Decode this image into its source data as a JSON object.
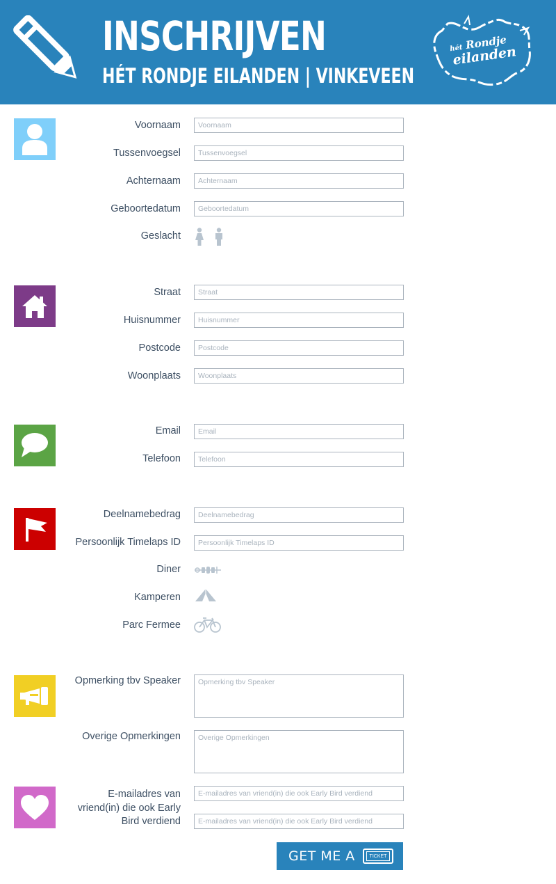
{
  "header": {
    "title": "INSCHRIJVEN",
    "subtitle": "HÉT RONDJE EILANDEN  |  VINKEVEEN",
    "logo_line1_small": "hét",
    "logo_line1": "Rondje",
    "logo_line2": "eilanden",
    "color": "#2983bb"
  },
  "sections": {
    "personal": {
      "icon": "person-icon",
      "color": "#7fcffa",
      "voornaam": {
        "label": "Voornaam",
        "placeholder": "Voornaam"
      },
      "tussenvoegsel": {
        "label": "Tussenvoegsel",
        "placeholder": "Tussenvoegsel"
      },
      "achternaam": {
        "label": "Achternaam",
        "placeholder": "Achternaam"
      },
      "geboortedatum": {
        "label": "Geboortedatum",
        "placeholder": "Geboortedatum"
      },
      "geslacht": {
        "label": "Geslacht",
        "options": [
          "female-icon",
          "male-icon"
        ]
      }
    },
    "address": {
      "icon": "house-icon",
      "color": "#7d3b88",
      "straat": {
        "label": "Straat",
        "placeholder": "Straat"
      },
      "huisnummer": {
        "label": "Huisnummer",
        "placeholder": "Huisnummer"
      },
      "postcode": {
        "label": "Postcode",
        "placeholder": "Postcode"
      },
      "woonplaats": {
        "label": "Woonplaats",
        "placeholder": "Woonplaats"
      }
    },
    "contact": {
      "icon": "speech-bubble-icon",
      "color": "#5ba445",
      "email": {
        "label": "Email",
        "placeholder": "Email"
      },
      "telefoon": {
        "label": "Telefoon",
        "placeholder": "Telefoon"
      }
    },
    "participation": {
      "icon": "flag-icon",
      "color": "#cc0000",
      "deelnamebedrag": {
        "label": "Deelnamebedrag",
        "placeholder": "Deelnamebedrag"
      },
      "timelaps": {
        "label": "Persoonlijk Timelaps ID",
        "placeholder": "Persoonlijk Timelaps ID"
      },
      "diner": {
        "label": "Diner",
        "icon": "skewer-icon"
      },
      "kamperen": {
        "label": "Kamperen",
        "icon": "tent-icon"
      },
      "parc_fermee": {
        "label": "Parc Fermee",
        "icon": "bicycle-icon"
      }
    },
    "remarks": {
      "icon": "megaphone-icon",
      "color": "#f1cf24",
      "speaker": {
        "label": "Opmerking tbv Speaker",
        "placeholder": "Opmerking tbv Speaker"
      },
      "overige": {
        "label": "Overige Opmerkingen",
        "placeholder": "Overige Opmerkingen"
      }
    },
    "friends": {
      "icon": "heart-icon",
      "color": "#d169c9",
      "label_line1": "E-mailadres van",
      "label_line2": "vriend(in) die ook Early",
      "label_line3": "Bird verdiend",
      "placeholder": "E-mailadres van vriend(in) die ook Early Bird verdiend"
    }
  },
  "submit": {
    "label": "GET ME A",
    "ticket_label": "TICKET"
  },
  "colors": {
    "label": "#3d4f63",
    "input_border": "#aab3bd",
    "placeholder": "#a9b3bd",
    "option_icon": "#b8c4cf"
  }
}
